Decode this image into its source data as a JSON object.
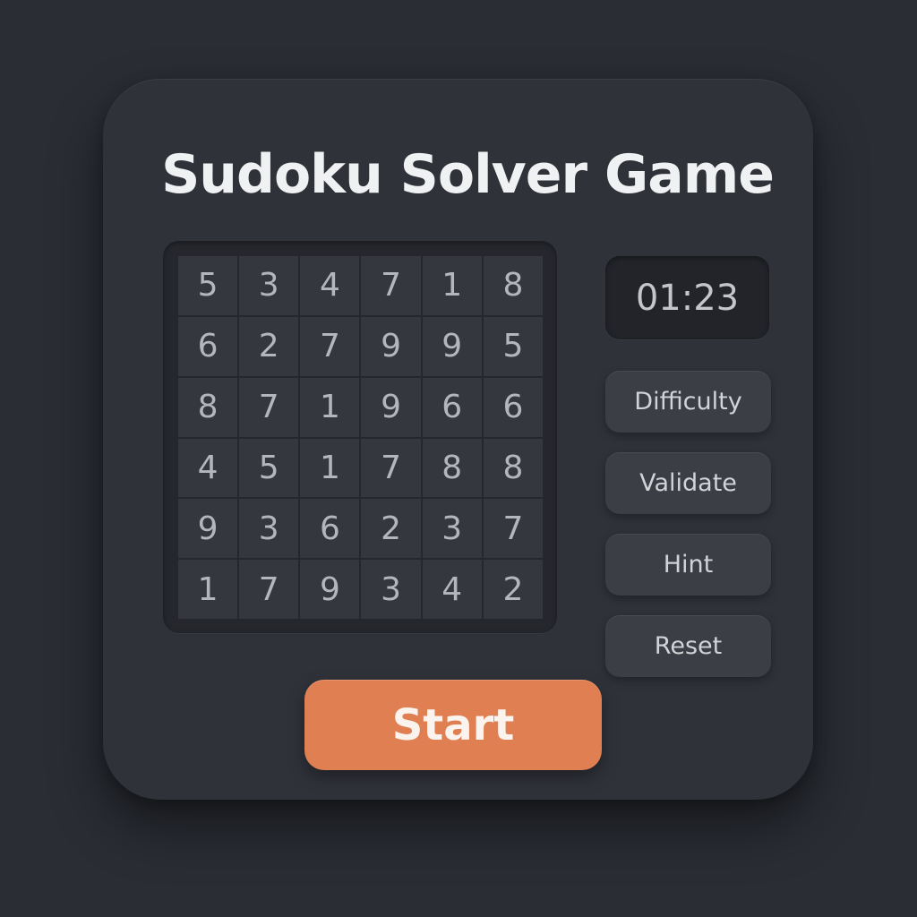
{
  "title": "Sudoku Solver Game",
  "board": {
    "rows": [
      [
        "5",
        "3",
        "4",
        "7",
        "1",
        "8"
      ],
      [
        "6",
        "2",
        "7",
        "9",
        "9",
        "5"
      ],
      [
        "8",
        "7",
        "1",
        "9",
        "6",
        "6"
      ],
      [
        "4",
        "5",
        "1",
        "7",
        "8",
        "8"
      ],
      [
        "9",
        "3",
        "6",
        "2",
        "3",
        "7"
      ],
      [
        "1",
        "7",
        "9",
        "3",
        "4",
        "2"
      ]
    ]
  },
  "timer": "01:23",
  "controls": {
    "difficulty_label": "Difficulty",
    "validate_label": "Validate",
    "hint_label": "Hint",
    "reset_label": "Reset"
  },
  "start_label": "Start",
  "colors": {
    "background": "#2a2d34",
    "card": "#2f3239",
    "accent": "#e07f52"
  }
}
